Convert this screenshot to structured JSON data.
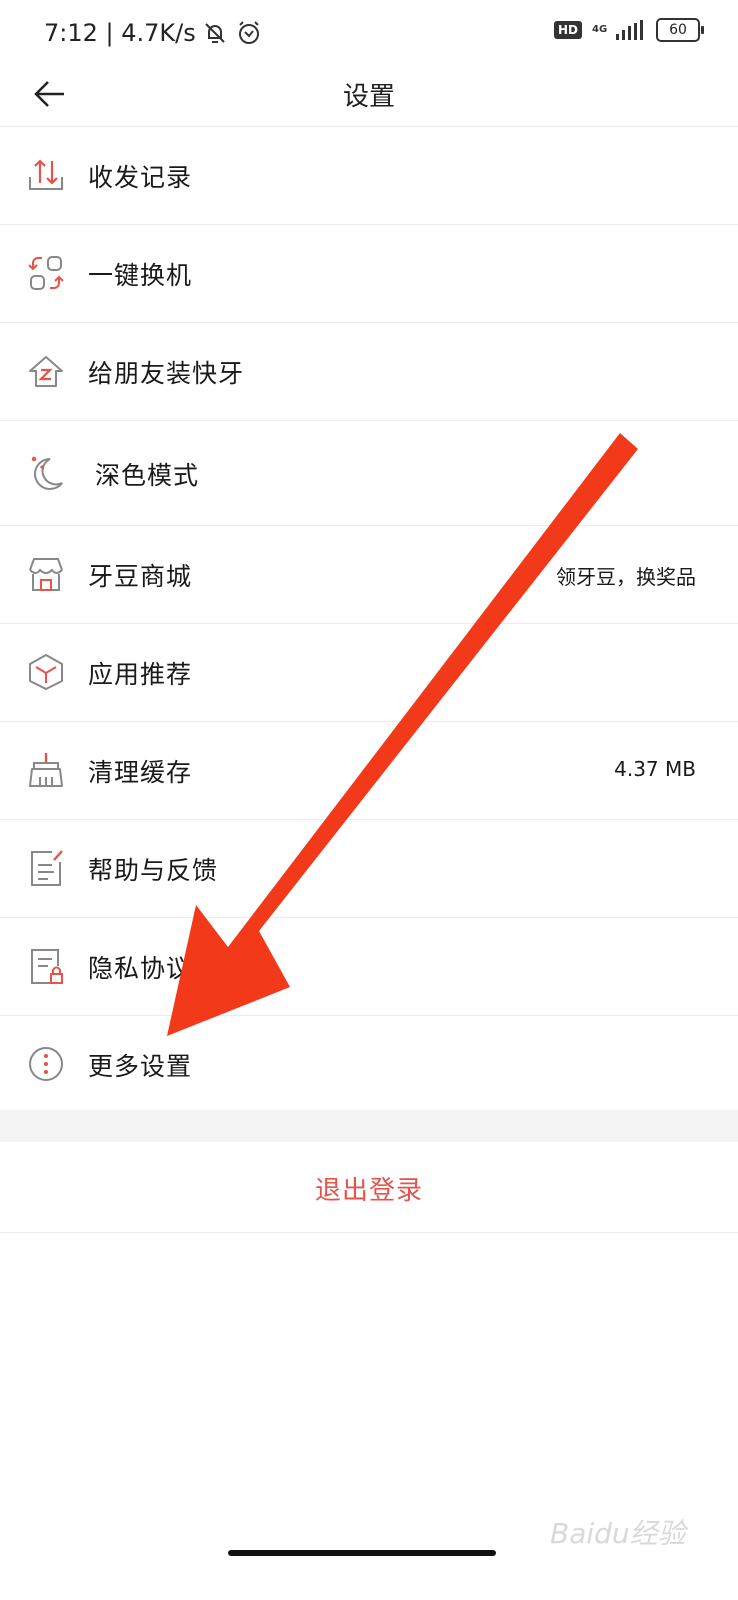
{
  "status_bar": {
    "time_speed": "7:12 | 4.7K/s",
    "hd": "HD",
    "network": "4G",
    "battery": "60"
  },
  "header": {
    "title": "设置"
  },
  "menu": [
    {
      "label": "收发记录",
      "value": "",
      "icon": "transfer-record-icon"
    },
    {
      "label": "一键换机",
      "value": "",
      "icon": "phone-switch-icon"
    },
    {
      "label": "给朋友装快牙",
      "value": "",
      "icon": "share-install-icon"
    },
    {
      "label": "深色模式",
      "value": "",
      "icon": "moon-icon"
    },
    {
      "label": "牙豆商城",
      "value": "领牙豆，换奖品",
      "icon": "store-icon"
    },
    {
      "label": "应用推荐",
      "value": "",
      "icon": "box-icon"
    },
    {
      "label": "清理缓存",
      "value": "4.37 MB",
      "icon": "broom-icon"
    },
    {
      "label": "帮助与反馈",
      "value": "",
      "icon": "feedback-icon"
    },
    {
      "label": "隐私协议",
      "value": "",
      "icon": "privacy-icon"
    },
    {
      "label": "更多设置",
      "value": "",
      "icon": "more-icon"
    }
  ],
  "logout": {
    "label": "退出登录"
  },
  "watermark": "Baidu经验",
  "colors": {
    "accent": "#e5534b",
    "annotation_arrow": "#f2391a"
  }
}
